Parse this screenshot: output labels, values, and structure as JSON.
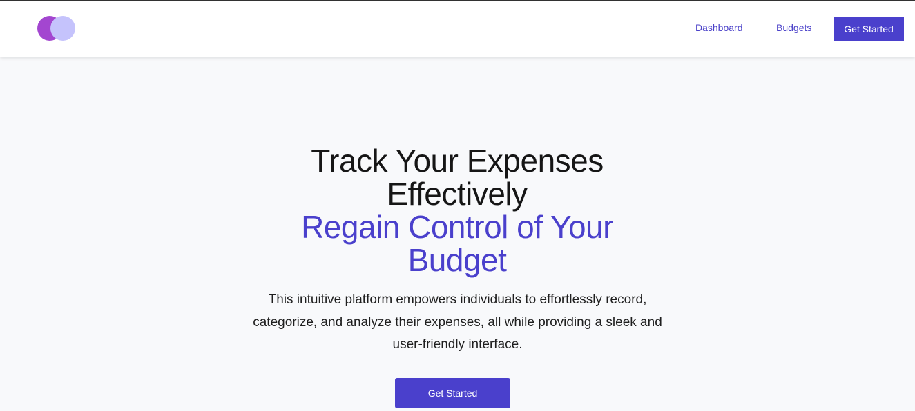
{
  "header": {
    "logo_icon": "two-overlapping-circles-logo",
    "nav": {
      "dashboard_label": "Dashboard",
      "budgets_label": "Budgets",
      "cta_label": "Get Started"
    }
  },
  "hero": {
    "headline_primary": "Track Your Expenses Effectively",
    "headline_accent": "Regain Control of Your Budget",
    "description": "This intuitive platform empowers individuals to effortlessly record, categorize, and analyze their expenses, all while providing a sleek and user-friendly interface.",
    "cta_label": "Get Started"
  },
  "colors": {
    "accent": "#4a40cc",
    "logo_left": "#a346d0",
    "logo_right": "#c5c3fc",
    "background": "#f8f9fb",
    "heading": "#161616"
  }
}
